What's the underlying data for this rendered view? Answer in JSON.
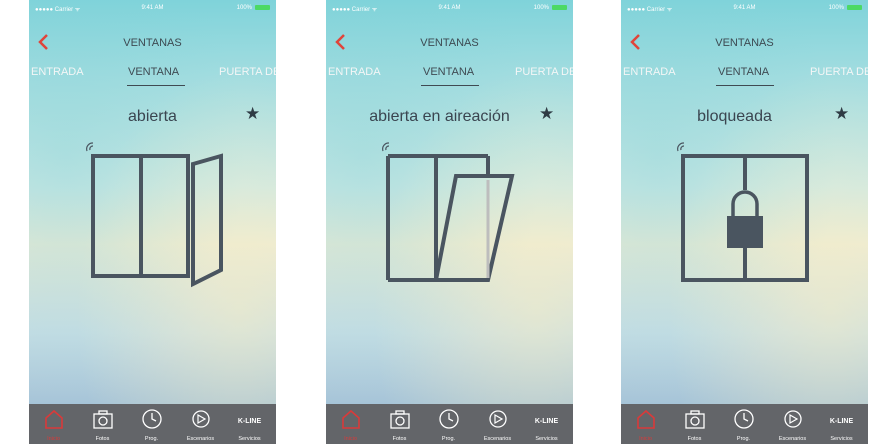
{
  "status_bar": {
    "carrier": "●●●●● Carrier ᯤ",
    "time": "9:41 AM",
    "battery": "100%"
  },
  "nav": {
    "title": "VENTANAS"
  },
  "tabs": {
    "left": "ENTRADA",
    "center": "VENTANA",
    "right": "PUERTA DE"
  },
  "screens": [
    {
      "state": "abierta"
    },
    {
      "state": "abierta en aireación"
    },
    {
      "state": "bloqueada"
    }
  ],
  "star_glyph": "★",
  "tabbar": {
    "home": "Inicio",
    "fotos": "Fotos",
    "prog": "Prog.",
    "escenarios": "Escenarios",
    "kline": "K-LINE",
    "servicios": "Servicios"
  },
  "colors": {
    "accent_red": "#d93a3a",
    "tabbar_bg": "#636569",
    "icon_dark": "#4a5560"
  }
}
